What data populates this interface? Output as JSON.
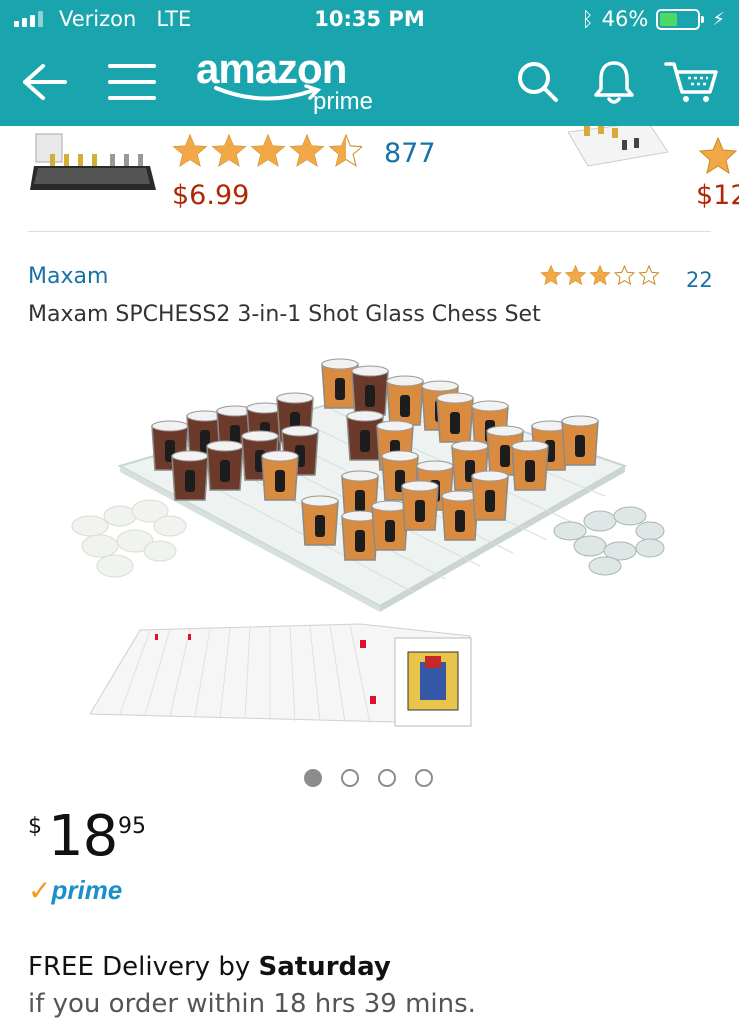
{
  "status_bar": {
    "carrier": "Verizon",
    "network": "LTE",
    "time": "10:35 PM",
    "battery_percent": "46%",
    "battery_level": 0.46
  },
  "nav": {
    "logo_word": "amazon",
    "logo_sub": "prime",
    "icons": [
      "back-arrow-icon",
      "menu-icon",
      "search-icon",
      "bell-icon",
      "cart-icon"
    ]
  },
  "previous_items": [
    {
      "rating": 4.5,
      "review_count": "877",
      "price": "$6.99"
    },
    {
      "price": "$12"
    }
  ],
  "product": {
    "brand": "Maxam",
    "rating": 3,
    "review_count": "22",
    "title": "Maxam SPCHESS2 3-in-1 Shot Glass Chess Set",
    "image_count": 4,
    "active_image": 1,
    "price": {
      "currency": "$",
      "whole": "18",
      "fraction": "95"
    },
    "prime_label": "prime",
    "delivery": {
      "prefix": "FREE Delivery by ",
      "day": "Saturday",
      "condition": "if you order within 18 hrs 39 mins."
    }
  },
  "colors": {
    "header": "#1aa5ae",
    "link": "#1673a7",
    "price": "#b12704",
    "star": "#f3a847",
    "prime_check": "#f29a1a",
    "prime_text": "#1a8fc9"
  }
}
